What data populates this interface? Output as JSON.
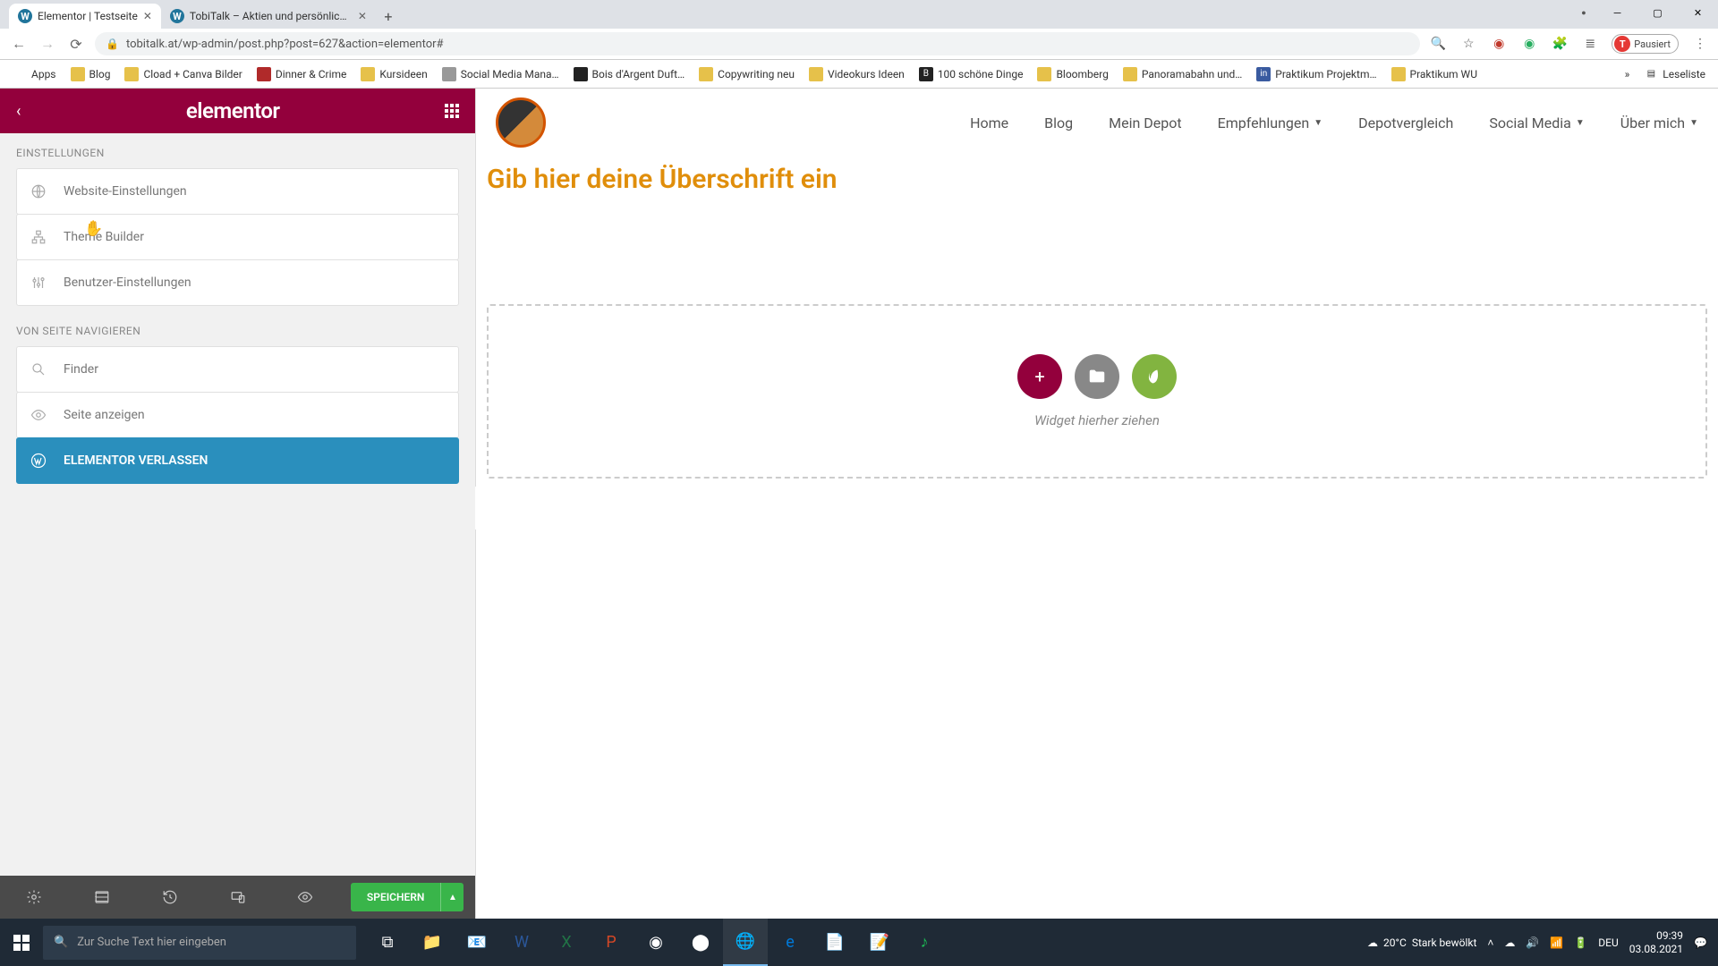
{
  "browser": {
    "tabs": [
      {
        "title": "Elementor | Testseite",
        "active": true
      },
      {
        "title": "TobiTalk – Aktien und persönlich…",
        "active": false
      }
    ],
    "url": "tobitalk.at/wp-admin/post.php?post=627&action=elementor#",
    "profile_status": "Pausiert",
    "profile_initial": "T",
    "bookmarks": [
      {
        "label": "Apps",
        "color": "#5f6368"
      },
      {
        "label": "Blog",
        "color": "#e6c14a"
      },
      {
        "label": "Cload + Canva Bilder",
        "color": "#e6c14a"
      },
      {
        "label": "Dinner & Crime",
        "color": "#b02a2a"
      },
      {
        "label": "Kursideen",
        "color": "#e6c14a"
      },
      {
        "label": "Social Media Mana…",
        "color": "#999"
      },
      {
        "label": "Bois d'Argent Duft…",
        "color": "#222"
      },
      {
        "label": "Copywriting neu",
        "color": "#e6c14a"
      },
      {
        "label": "Videokurs Ideen",
        "color": "#e6c14a"
      },
      {
        "label": "100 schöne Dinge",
        "color": "#222"
      },
      {
        "label": "Bloomberg",
        "color": "#e6c14a"
      },
      {
        "label": "Panoramabahn und…",
        "color": "#e6c14a"
      },
      {
        "label": "Praktikum Projektm…",
        "color": "#3a5ba0"
      },
      {
        "label": "Praktikum WU",
        "color": "#e6c14a"
      }
    ],
    "readlist": "Leseliste"
  },
  "panel": {
    "logo": "elementor",
    "section_settings": "EINSTELLUNGEN",
    "section_navigate": "VON SEITE NAVIGIEREN",
    "items_settings": [
      {
        "label": "Website-Einstellungen",
        "icon": "globe"
      },
      {
        "label": "Theme Builder",
        "icon": "sitemap"
      },
      {
        "label": "Benutzer-Einstellungen",
        "icon": "sliders"
      }
    ],
    "items_navigate": [
      {
        "label": "Finder",
        "icon": "search"
      },
      {
        "label": "Seite anzeigen",
        "icon": "eye"
      }
    ],
    "exit_label": "ELEMENTOR VERLASSEN",
    "save_label": "SPEICHERN"
  },
  "site": {
    "nav": [
      {
        "label": "Home",
        "dropdown": false
      },
      {
        "label": "Blog",
        "dropdown": false
      },
      {
        "label": "Mein Depot",
        "dropdown": false
      },
      {
        "label": "Empfehlungen",
        "dropdown": true
      },
      {
        "label": "Depotvergleich",
        "dropdown": false
      },
      {
        "label": "Social Media",
        "dropdown": true
      },
      {
        "label": "Über mich",
        "dropdown": true
      }
    ],
    "heading": "Gib hier deine Überschrift ein",
    "drop_hint": "Widget hierher ziehen"
  },
  "taskbar": {
    "search_placeholder": "Zur Suche Text hier eingeben",
    "weather_temp": "20°C",
    "weather_text": "Stark bewölkt",
    "lang": "DEU",
    "time": "09:39",
    "date": "03.08.2021"
  }
}
